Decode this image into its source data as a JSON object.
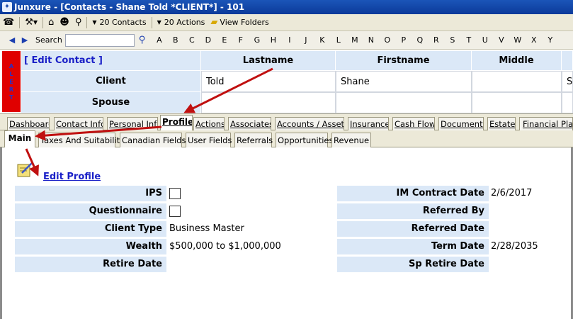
{
  "window": {
    "title": "Junxure - [Contacts - Shane Told *CLIENT*] - 101"
  },
  "toolbar": {
    "contacts_label": "20 Contacts",
    "actions_label": "20 Actions",
    "view_folders_label": "View Folders"
  },
  "alphabar": {
    "search_label": "Search",
    "letters": [
      "A",
      "B",
      "C",
      "D",
      "E",
      "F",
      "G",
      "H",
      "I",
      "J",
      "K",
      "L",
      "M",
      "N",
      "O",
      "P",
      "Q",
      "R",
      "S",
      "T",
      "U",
      "V",
      "W",
      "X",
      "Y"
    ]
  },
  "alert": {
    "letters": [
      "A",
      "L",
      "E",
      "R",
      "T"
    ]
  },
  "header_grid": {
    "edit_contact": "[ Edit Contact ]",
    "col_lastname": "Lastname",
    "col_firstname": "Firstname",
    "col_middle": "Middle",
    "row_client": "Client",
    "row_spouse": "Spouse",
    "client_lastname": "Told",
    "client_firstname": "Shane",
    "client_extra": "Sh"
  },
  "tabs": [
    "Dashboard",
    "Contact Info",
    "Personal Info",
    "Profile",
    "Actions",
    "Associates",
    "Accounts / Assets",
    "Insurance",
    "Cash Flow",
    "Documents",
    "Estate",
    "Financial Planning"
  ],
  "active_tab": "Profile",
  "subtabs": [
    "Main",
    "Taxes And Suitability",
    "Canadian Fields",
    "User Fields",
    "Referrals",
    "Opportunities",
    "Revenue"
  ],
  "active_subtab": "Main",
  "profile": {
    "edit_profile": "Edit Profile",
    "ips_label": "IPS",
    "questionnaire_label": "Questionnaire",
    "client_type_label": "Client Type",
    "client_type_value": "Business Master",
    "wealth_label": "Wealth",
    "wealth_value": "$500,000 to $1,000,000",
    "retire_date_label": "Retire Date",
    "im_contract_date_label": "IM Contract Date",
    "im_contract_date_value": "2/6/2017",
    "referred_by_label": "Referred By",
    "referred_date_label": "Referred Date",
    "term_date_label": "Term Date",
    "term_date_value": "2/28/2035",
    "sp_retire_date_label": "Sp Retire Date"
  },
  "colors": {
    "label_bg": "#dbe8f7",
    "alert": "#e00000",
    "link": "#1a20c7",
    "arrow": "#c01010"
  }
}
